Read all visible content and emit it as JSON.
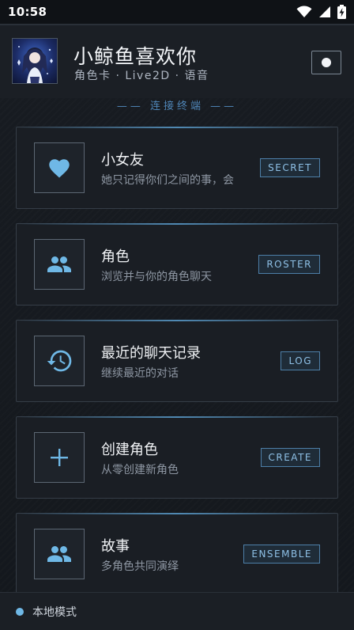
{
  "status_bar": {
    "time": "10:58",
    "icons": [
      "wifi-icon",
      "signal-icon",
      "battery-charging-icon"
    ]
  },
  "header": {
    "title": "小鲸鱼喜欢你",
    "subtitle": "角色卡 · Live2D · 语音",
    "avatar_icon": "character-avatar",
    "toggle_icon": "toggle-dot-icon"
  },
  "section_label": "—— 连接终端 ——",
  "cards": [
    {
      "title": "小女友",
      "description": "她只记得你们之间的事，会",
      "tag": "SECRET",
      "icon": "heart-icon"
    },
    {
      "title": "角色",
      "description": "浏览并与你的角色聊天",
      "tag": "ROSTER",
      "icon": "people-icon"
    },
    {
      "title": "最近的聊天记录",
      "description": "继续最近的对话",
      "tag": "LOG",
      "icon": "history-icon"
    },
    {
      "title": "创建角色",
      "description": "从零创建新角色",
      "tag": "CREATE",
      "icon": "plus-icon"
    },
    {
      "title": "故事",
      "description": "多角色共同演绎",
      "tag": "ENSEMBLE",
      "icon": "people-icon"
    }
  ],
  "footer": {
    "mode_label": "本地模式",
    "indicator_color": "#6fb8e6"
  },
  "colors": {
    "accent": "#6fb8e6",
    "tag_border": "#4d7fa8",
    "background": "#15191f"
  }
}
